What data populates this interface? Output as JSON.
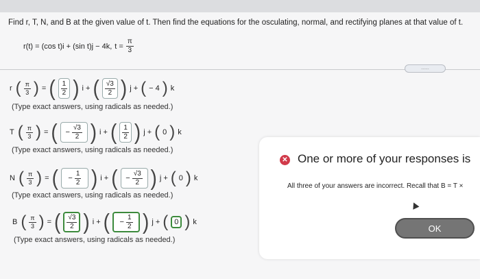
{
  "problem": {
    "text": "Find r, T, N, and B at the given value of t. Then find the equations for the osculating, normal, and rectifying planes at that value of t.",
    "r_def": "r(t) = (cos t)i + (sin t)j − 4k,",
    "t_label": "t =",
    "t_num": "π",
    "t_den": "3"
  },
  "more_button": "......",
  "note": "(Type exact answers, using radicals as needed.)",
  "answers": {
    "r": {
      "name": "r",
      "arg_num": "π",
      "arg_den": "3",
      "eq": "=",
      "i_num": "1",
      "i_den": "2",
      "i_suffix": "i +",
      "j_num": "√3",
      "j_den": "2",
      "j_suffix": "j +",
      "k_val": "− 4",
      "k_suffix": "k"
    },
    "T": {
      "name": "T",
      "arg_num": "π",
      "arg_den": "3",
      "eq": "=",
      "i_sign": "−",
      "i_num": "√3",
      "i_den": "2",
      "i_suffix": "i +",
      "j_num": "1",
      "j_den": "2",
      "j_suffix": "j +",
      "k_val": "0",
      "k_suffix": "k"
    },
    "N": {
      "name": "N",
      "arg_num": "π",
      "arg_den": "3",
      "eq": "=",
      "i_sign": "−",
      "i_num": "1",
      "i_den": "2",
      "i_suffix": "i +",
      "j_sign": "−",
      "j_num": "√3",
      "j_den": "2",
      "j_suffix": "j +",
      "k_val": "0",
      "k_suffix": "k"
    },
    "B": {
      "name": "B",
      "arg_num": "π",
      "arg_den": "3",
      "eq": "=",
      "i_num": "√3",
      "i_den": "2",
      "i_suffix": "i +",
      "j_sign": "−",
      "j_num": "1",
      "j_den": "2",
      "j_suffix": "j +",
      "k_val": "0",
      "k_suffix": "k"
    }
  },
  "feedback": {
    "title": "One or more of your responses is",
    "message": "All three of your answers are incorrect. Recall that B = T ×",
    "ok_label": "OK",
    "error_color": "#d13a4a"
  }
}
